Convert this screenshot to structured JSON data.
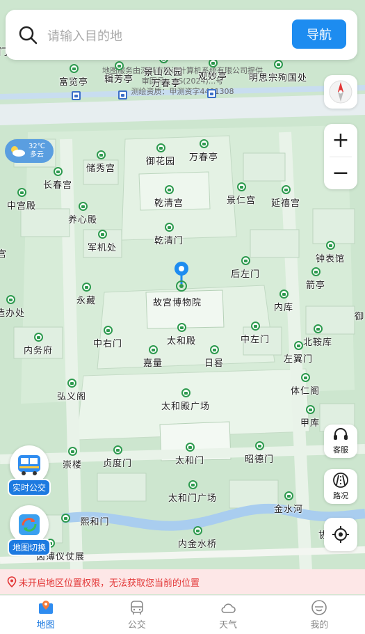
{
  "search": {
    "placeholder": "请输入目的地",
    "nav_label": "导航"
  },
  "map": {
    "credit_lines": [
      "地图服务由深圳市腾讯计算机系统有限公司提供",
      "审图号：GS(2024)...号",
      "测绘资质：甲测资字4401308"
    ],
    "pois": [
      {
        "name": "富览亭"
      },
      {
        "name": "辑芳亭"
      },
      {
        "name": "景山公园"
      },
      {
        "name": "观妙亭"
      },
      {
        "name": "明思宗殉国处"
      },
      {
        "name": "万春亭"
      },
      {
        "name": "御花园"
      },
      {
        "name": "万春亭"
      },
      {
        "name": "储秀宫"
      },
      {
        "name": "长春宫"
      },
      {
        "name": "乾清宫"
      },
      {
        "name": "景仁宫"
      },
      {
        "name": "延禧宫"
      },
      {
        "name": "中宫殿"
      },
      {
        "name": "养心殿"
      },
      {
        "name": "乾清门"
      },
      {
        "name": "军机处"
      },
      {
        "name": "钟表馆"
      },
      {
        "name": "后左门"
      },
      {
        "name": "箭亭"
      },
      {
        "name": "永藏"
      },
      {
        "name": "故宫博物院"
      },
      {
        "name": "内库"
      },
      {
        "name": "造办处"
      },
      {
        "name": "太和殿"
      },
      {
        "name": "北鞍库"
      },
      {
        "name": "内务府"
      },
      {
        "name": "中右门"
      },
      {
        "name": "中左门"
      },
      {
        "name": "嘉量"
      },
      {
        "name": "日晷"
      },
      {
        "name": "左翼门"
      },
      {
        "name": "弘义阁"
      },
      {
        "name": "体仁阁"
      },
      {
        "name": "太和殿广场"
      },
      {
        "name": "甲库"
      },
      {
        "name": "崇楼"
      },
      {
        "name": "贞度门"
      },
      {
        "name": "太和门"
      },
      {
        "name": "昭德门"
      },
      {
        "name": "太和门广场"
      },
      {
        "name": "金水河"
      },
      {
        "name": "熙和门"
      },
      {
        "name": "内金水桥"
      },
      {
        "name": "卤薄仪仗展"
      }
    ],
    "edge_labels": [
      "门",
      "宫",
      "御",
      "协"
    ]
  },
  "weather": {
    "temp": "32℃",
    "desc": "多云"
  },
  "controls": {
    "zoom_in": "+",
    "zoom_out": "−",
    "service_label": "客服",
    "traffic_label": "路况"
  },
  "floating": {
    "bus_label": "实时公交",
    "switch_label": "地图切换"
  },
  "warning": "未开启地区位置权限，无法获取您当前的位置",
  "tabs": [
    {
      "label": "地图",
      "active": true,
      "icon": "map-pin-icon"
    },
    {
      "label": "公交",
      "active": false,
      "icon": "bus-icon"
    },
    {
      "label": "天气",
      "active": false,
      "icon": "cloud-icon"
    },
    {
      "label": "我的",
      "active": false,
      "icon": "user-icon"
    }
  ],
  "colors": {
    "accent": "#1d8cf0",
    "warning_text": "#e23636",
    "poi_green": "#2d9a4e"
  }
}
